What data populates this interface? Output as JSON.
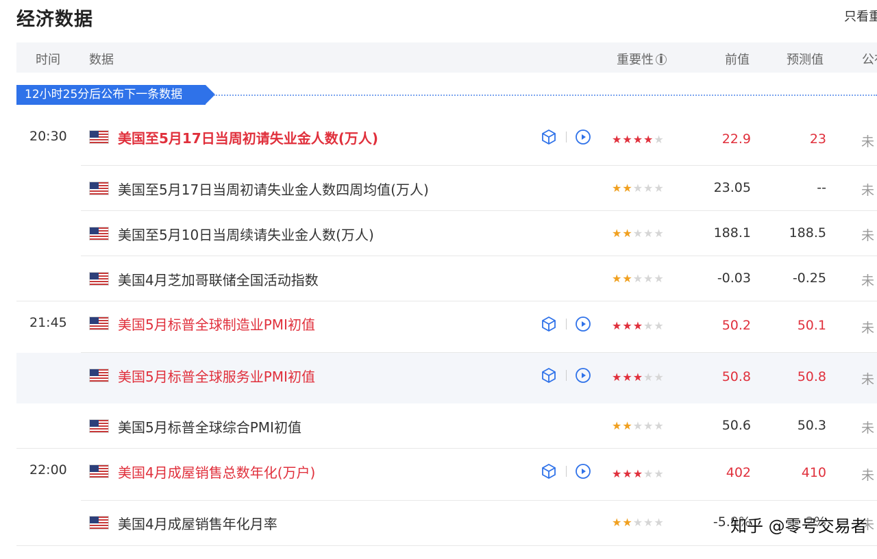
{
  "page": {
    "title": "经济数据",
    "filter_link": "只看重"
  },
  "header": {
    "time": "时间",
    "data": "数据",
    "importance": "重要性",
    "info_icon": "i",
    "previous": "前值",
    "forecast": "预测值",
    "published": "公布"
  },
  "banner": {
    "text": "12小时25分后公布下一条数据"
  },
  "rows": [
    {
      "time": "20:30",
      "title": "美国至5月17日当周初请失业金人数(万人)",
      "stars": [
        "★",
        "★",
        "★",
        "★"
      ],
      "stars_off": [
        "★"
      ],
      "importance": 4,
      "previous": "22.9",
      "forecast": "23",
      "published": "未"
    },
    {
      "time": "",
      "title": "美国至5月17日当周初请失业金人数四周均值(万人)",
      "stars": [
        "★",
        "★"
      ],
      "stars_off": [
        "★",
        "★",
        "★"
      ],
      "importance": 2,
      "previous": "23.05",
      "forecast": "--",
      "published": "未"
    },
    {
      "time": "",
      "title": "美国至5月10日当周续请失业金人数(万人)",
      "stars": [
        "★",
        "★"
      ],
      "stars_off": [
        "★",
        "★",
        "★"
      ],
      "importance": 2,
      "previous": "188.1",
      "forecast": "188.5",
      "published": "未"
    },
    {
      "time": "",
      "title": "美国4月芝加哥联储全国活动指数",
      "stars": [
        "★",
        "★"
      ],
      "stars_off": [
        "★",
        "★",
        "★"
      ],
      "importance": 2,
      "previous": "-0.03",
      "forecast": "-0.25",
      "published": "未"
    },
    {
      "time": "21:45",
      "title": "美国5月标普全球制造业PMI初值",
      "stars": [
        "★",
        "★",
        "★"
      ],
      "stars_off": [
        "★",
        "★"
      ],
      "importance": 3,
      "previous": "50.2",
      "forecast": "50.1",
      "published": "未"
    },
    {
      "time": "",
      "title": "美国5月标普全球服务业PMI初值",
      "stars": [
        "★",
        "★",
        "★"
      ],
      "stars_off": [
        "★",
        "★"
      ],
      "importance": 3,
      "previous": "50.8",
      "forecast": "50.8",
      "published": "未"
    },
    {
      "time": "",
      "title": "美国5月标普全球综合PMI初值",
      "stars": [
        "★",
        "★"
      ],
      "stars_off": [
        "★",
        "★",
        "★"
      ],
      "importance": 2,
      "previous": "50.6",
      "forecast": "50.3",
      "published": "未"
    },
    {
      "time": "22:00",
      "title": "美国4月成屋销售总数年化(万户)",
      "stars": [
        "★",
        "★",
        "★"
      ],
      "stars_off": [
        "★",
        "★"
      ],
      "importance": 3,
      "previous": "402",
      "forecast": "410",
      "published": "未"
    },
    {
      "time": "",
      "title": "美国4月成屋销售年化月率",
      "stars": [
        "★",
        "★"
      ],
      "stars_off": [
        "★",
        "★",
        "★"
      ],
      "importance": 2,
      "previous": "-5.9%",
      "forecast": "2%",
      "published": "未"
    }
  ],
  "watermark": {
    "text": "知乎 @零号交易者"
  },
  "colors": {
    "accent_blue": "#2f72e9",
    "highlight_red": "#e0303c",
    "star_gold": "#f0a020",
    "header_bg": "#f4f5f8"
  }
}
